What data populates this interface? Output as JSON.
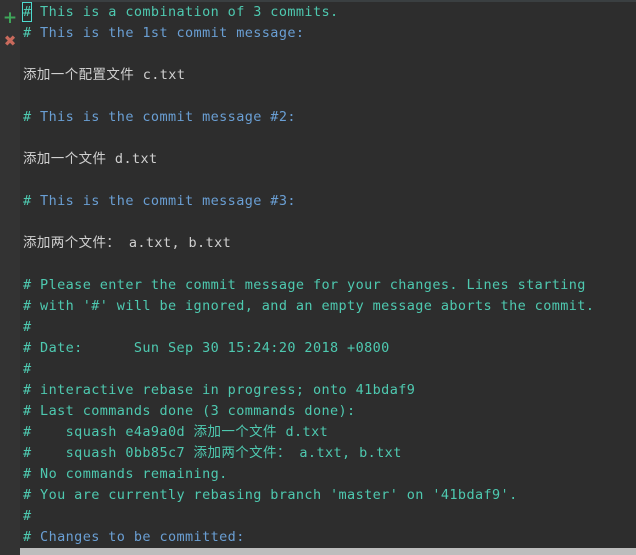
{
  "window": {
    "title": "git commit message editor",
    "background_color": "#2d2d2d",
    "gutter_color": "#333333"
  },
  "colors": {
    "comment_teal": "#4ec9b0",
    "comment_blue": "#6a9fd4",
    "plain_text": "#d0d0d0",
    "cursor_border": "#4ddbd0",
    "marker_add": "#3fa65a",
    "marker_delete": "#c96a5c",
    "status_bar": "#bdbdbd"
  },
  "gutter": {
    "markers": [
      {
        "icon": "plus-icon",
        "glyph": "+",
        "color": "#3fa65a"
      },
      {
        "icon": "cross-icon",
        "glyph": "✖",
        "color": "#c96a5c"
      }
    ]
  },
  "cursor": {
    "line": 1,
    "column": 1,
    "char": "#"
  },
  "editor": {
    "lines": [
      {
        "n": 1,
        "hash": "#",
        "text": " This is a combination of 3 commits.",
        "style": "teal"
      },
      {
        "n": 2,
        "hash": "#",
        "text": " This is the 1st commit message:",
        "style": "blue"
      },
      {
        "n": 3,
        "hash": "",
        "text": "",
        "style": "plain"
      },
      {
        "n": 4,
        "hash": "",
        "text": "添加一个配置文件 c.txt",
        "style": "plain"
      },
      {
        "n": 5,
        "hash": "",
        "text": "",
        "style": "plain"
      },
      {
        "n": 6,
        "hash": "#",
        "text": " This is the commit message #2:",
        "style": "blue"
      },
      {
        "n": 7,
        "hash": "",
        "text": "",
        "style": "plain"
      },
      {
        "n": 8,
        "hash": "",
        "text": "添加一个文件 d.txt",
        "style": "plain"
      },
      {
        "n": 9,
        "hash": "",
        "text": "",
        "style": "plain"
      },
      {
        "n": 10,
        "hash": "#",
        "text": " This is the commit message #3:",
        "style": "blue"
      },
      {
        "n": 11,
        "hash": "",
        "text": "",
        "style": "plain"
      },
      {
        "n": 12,
        "hash": "",
        "text": "添加两个文件： a.txt, b.txt",
        "style": "plain"
      },
      {
        "n": 13,
        "hash": "",
        "text": "",
        "style": "plain"
      },
      {
        "n": 14,
        "hash": "#",
        "text": " Please enter the commit message for your changes. Lines starting",
        "style": "teal"
      },
      {
        "n": 15,
        "hash": "#",
        "text": " with '#' will be ignored, and an empty message aborts the commit.",
        "style": "teal"
      },
      {
        "n": 16,
        "hash": "#",
        "text": "",
        "style": "teal"
      },
      {
        "n": 17,
        "hash": "#",
        "text": " Date:      Sun Sep 30 15:24:20 2018 +0800",
        "style": "teal"
      },
      {
        "n": 18,
        "hash": "#",
        "text": "",
        "style": "teal"
      },
      {
        "n": 19,
        "hash": "#",
        "text": " interactive rebase in progress; onto 41bdaf9",
        "style": "teal"
      },
      {
        "n": 20,
        "hash": "#",
        "text": " Last commands done (3 commands done):",
        "style": "teal"
      },
      {
        "n": 21,
        "hash": "#",
        "text": "    squash e4a9a0d 添加一个文件 d.txt",
        "style": "teal"
      },
      {
        "n": 22,
        "hash": "#",
        "text": "    squash 0bb85c7 添加两个文件： a.txt, b.txt",
        "style": "teal"
      },
      {
        "n": 23,
        "hash": "#",
        "text": " No commands remaining.",
        "style": "teal"
      },
      {
        "n": 24,
        "hash": "#",
        "text": " You are currently rebasing branch 'master' on '41bdaf9'.",
        "style": "teal"
      },
      {
        "n": 25,
        "hash": "#",
        "text": "",
        "style": "teal"
      },
      {
        "n": 26,
        "hash": "#",
        "text": " Changes to be committed:",
        "style": "blue"
      }
    ]
  }
}
